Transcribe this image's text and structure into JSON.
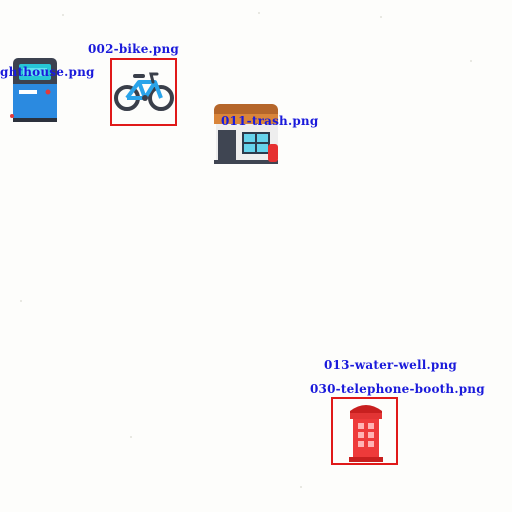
{
  "desktop": {
    "files": [
      {
        "id": "lighthouse",
        "label": "ghthouse.png",
        "icon": "ticket-machine-icon",
        "selected": false
      },
      {
        "id": "bike",
        "label": "002-bike.png",
        "icon": "bicycle-icon",
        "selected": true
      },
      {
        "id": "trash",
        "label": "011-trash.png",
        "icon": "shop-building-icon",
        "selected": false
      },
      {
        "id": "water-well",
        "label": "013-water-well.png",
        "icon": "",
        "selected": false
      },
      {
        "id": "telephone-booth",
        "label": "030-telephone-booth.png",
        "icon": "telephone-booth-icon",
        "selected": true
      }
    ]
  },
  "colors": {
    "label_text": "#1a1adb",
    "selection_border": "#e01919",
    "background": "#fdfdfb"
  }
}
